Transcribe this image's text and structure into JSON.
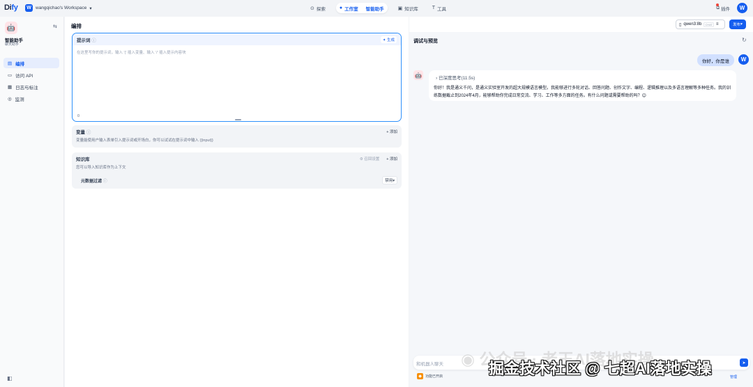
{
  "topbar": {
    "logo_main": "Di",
    "logo_accent": "fy",
    "workspace_badge": "W",
    "workspace_name": "wangqichao's Workspace",
    "nav": {
      "explore": "探索",
      "studio": "工作室",
      "current_app": "智能助手",
      "knowledge": "知识库",
      "tools": "工具"
    },
    "plugins": "插件",
    "avatar_letter": "W"
  },
  "sidebar": {
    "app_name": "智能助手",
    "app_type": "聊天助手",
    "items": [
      {
        "label": "编排",
        "icon": "layout-icon"
      },
      {
        "label": "访问 API",
        "icon": "terminal-icon"
      },
      {
        "label": "日志与标注",
        "icon": "document-icon"
      },
      {
        "label": "监测",
        "icon": "monitor-icon"
      }
    ]
  },
  "orchestrate": {
    "title": "编排",
    "prompt": {
      "label": "提示词",
      "info": "ⓘ",
      "generate": "生成",
      "placeholder": "在这里写你的提示词，输入 '{' 插入变量、输入 '/' 插入提示内容块",
      "count": "0"
    },
    "variables": {
      "title": "变量",
      "info": "ⓘ",
      "add": "+ 添加",
      "desc": "变量能使用户输入表单引入提示词或开场白，你可以试试在提示词中输入 {{input}}"
    },
    "knowledge": {
      "title": "知识库",
      "recall": "召回设置",
      "add": "+ 添加",
      "desc": "您可以导入知识库作为上下文",
      "metadata_title": "元数据过滤",
      "metadata_info": "ⓘ",
      "metadata_value": "禁用"
    }
  },
  "debug": {
    "model_name": "qwen3:8b",
    "model_tag": "CHAT",
    "publish": "发布",
    "title": "调试与预览",
    "user_message": "你好，你是谁",
    "user_avatar": "W",
    "think_label": "已深度思考(11.5s)",
    "bot_message": "你好！我是通义千问，是通义实验室开发的超大规模语言模型。我能够进行多轮对话、回答问题、创作文字、编程、逻辑推理以及多语言理解等多种任务。我的训练数据截止到2024年4月，能够帮助你完成日常交流、学习、工作等多方面的任务。有什么问题或需要帮助的吗？😊",
    "input_placeholder": "和机器人聊天",
    "feature_label": "功能已开启",
    "manage": "管理"
  },
  "watermark": {
    "text": "公众号 · 老王AI落地实操",
    "overlay": "掘金技术社区 @ 七超AI落地实操"
  }
}
